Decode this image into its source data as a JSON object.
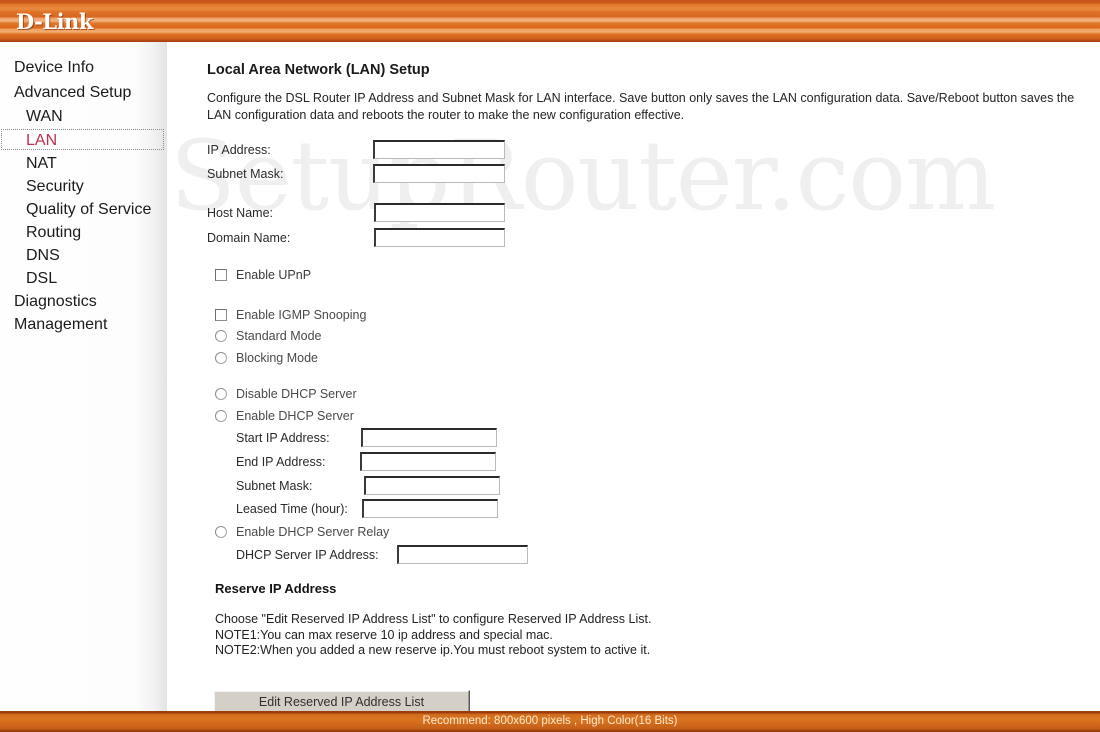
{
  "header": {
    "logo": "D-Link"
  },
  "sidebar": {
    "items": [
      {
        "label": "Device Info",
        "level": 0,
        "selected": false
      },
      {
        "label": "Advanced Setup",
        "level": 0,
        "selected": false
      },
      {
        "label": "WAN",
        "level": 1,
        "selected": false
      },
      {
        "label": "LAN",
        "level": 1,
        "selected": true
      },
      {
        "label": "NAT",
        "level": 1,
        "selected": false
      },
      {
        "label": "Security",
        "level": 1,
        "selected": false
      },
      {
        "label": "Quality of Service",
        "level": 1,
        "selected": false
      },
      {
        "label": "Routing",
        "level": 1,
        "selected": false
      },
      {
        "label": "DNS",
        "level": 1,
        "selected": false
      },
      {
        "label": "DSL",
        "level": 1,
        "selected": false
      },
      {
        "label": "Diagnostics",
        "level": 0,
        "selected": false
      },
      {
        "label": "Management",
        "level": 0,
        "selected": false
      }
    ],
    "selected_color": "#c1304c"
  },
  "watermark": {
    "text": "SetupRouter.com"
  },
  "main": {
    "title": "Local Area Network (LAN) Setup",
    "description": "Configure the DSL Router IP Address and Subnet Mask for LAN interface.  Save button only saves the LAN configuration data.  Save/Reboot button saves the LAN configuration data and reboots the router to make the new configuration effective.",
    "fields": {
      "ip_address_label": "IP Address:",
      "ip_address_value": "",
      "subnet_mask_label": "Subnet Mask:",
      "subnet_mask_value": "",
      "host_name_label": "Host Name:",
      "host_name_value": "",
      "domain_name_label": "Domain Name:",
      "domain_name_value": ""
    },
    "options": {
      "enable_upnp": "Enable UPnP",
      "enable_igmp_snooping": "Enable IGMP Snooping",
      "standard_mode": "Standard Mode",
      "blocking_mode": "Blocking Mode",
      "disable_dhcp_server": "Disable DHCP Server",
      "enable_dhcp_server": "Enable DHCP Server",
      "enable_dhcp_server_relay": "Enable DHCP Server Relay"
    },
    "dhcp": {
      "start_ip_label": "Start IP Address:",
      "start_ip_value": "",
      "end_ip_label": "End IP Address:",
      "end_ip_value": "",
      "subnet_mask_label": "Subnet Mask:",
      "subnet_mask_value": "",
      "leased_time_label": "Leased Time (hour):",
      "leased_time_value": "",
      "relay_ip_label": "DHCP Server IP Address:",
      "relay_ip_value": ""
    },
    "reserve": {
      "heading": "Reserve IP Address",
      "notes": "Choose \"Edit Reserved IP Address List\" to configure Reserved IP Address List.\nNOTE1:You can max reserve 10 ip address and special mac.\nNOTE2:When you added a new reserve ip.You must reboot system to active it.",
      "button_label": "Edit Reserved IP Address List"
    }
  },
  "footer": {
    "text": "Recommend: 800x600 pixels , High Color(16 Bits)",
    "accent_color": "#d9751f"
  }
}
